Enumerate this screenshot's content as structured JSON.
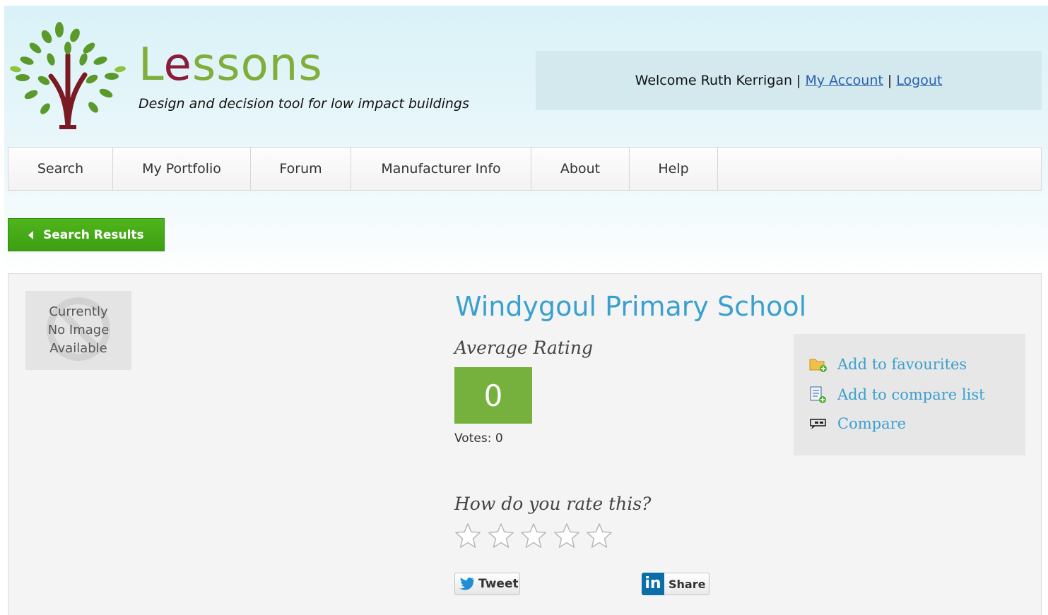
{
  "header": {
    "brand_prefix": "L",
    "brand_e": "e",
    "brand_suffix": "ssons",
    "tagline": "Design and decision tool for low impact buildings",
    "welcome": "Welcome Ruth Kerrigan",
    "separator": "|",
    "my_account": "My Account",
    "logout": "Logout"
  },
  "nav": {
    "items": [
      {
        "label": "Search"
      },
      {
        "label": "My Portfolio"
      },
      {
        "label": "Forum"
      },
      {
        "label": "Manufacturer Info"
      },
      {
        "label": "About"
      },
      {
        "label": "Help"
      }
    ]
  },
  "back_button": {
    "label": "Search Results"
  },
  "product": {
    "no_image_text": "Currently\nNo Image\nAvailable",
    "title": "Windygoul Primary School",
    "average_rating_label": "Average Rating",
    "average_rating": "0",
    "votes": "Votes: 0",
    "rate_prompt": "How do you rate this?",
    "user_rating": 0,
    "star_count": 5
  },
  "actions": {
    "favourites": "Add to favourites",
    "compare_list": "Add to compare list",
    "compare": "Compare"
  },
  "social": {
    "tweet": "Tweet",
    "linkedin_logo": "in",
    "share": "Share"
  },
  "colors": {
    "brand_green": "#7fae3a",
    "brand_red": "#8a1d3a",
    "button_green": "#46a817",
    "score_green": "#76b13d",
    "title_blue": "#3aa0cf",
    "link_blue": "#2a5fae"
  }
}
